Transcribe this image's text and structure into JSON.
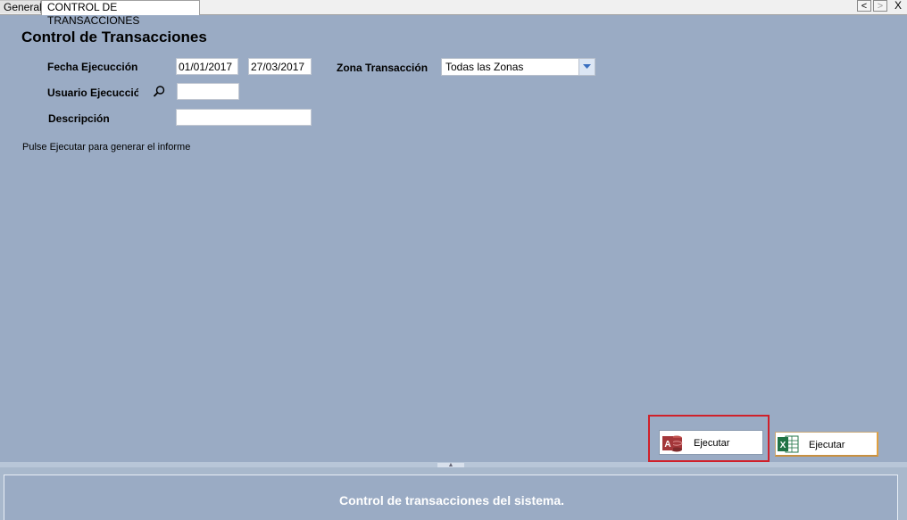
{
  "tabs": [
    {
      "label": "General"
    },
    {
      "label": "CONTROL DE TRANSACCIONES"
    }
  ],
  "nav": {
    "prev": "<",
    "next": ">",
    "close": "X"
  },
  "form": {
    "title": "Control de Transacciones",
    "fecha_label": "Fecha Ejecucción",
    "fecha_desde": "01/01/2017",
    "fecha_hasta": "27/03/2017",
    "usuario_label": "Usuario Ejecucción",
    "usuario_value": "",
    "descripcion_label": "Descripción",
    "descripcion_value": "",
    "zona_label": "Zona Transacción",
    "zona_value": "Todas las Zonas",
    "hint": "Pulse Ejecutar para generar el informe"
  },
  "actions": {
    "access_label": "Ejecutar",
    "excel_label": "Ejecutar"
  },
  "footer": {
    "description": "Control de transacciones del sistema."
  },
  "icons": {
    "search": "search-icon",
    "access": "access-icon",
    "excel": "excel-icon",
    "dropdown": "chevron-down-icon"
  },
  "colors": {
    "background": "#9aabc4",
    "highlight": "#d0202a",
    "access": "#a4373a",
    "excel": "#217346"
  }
}
